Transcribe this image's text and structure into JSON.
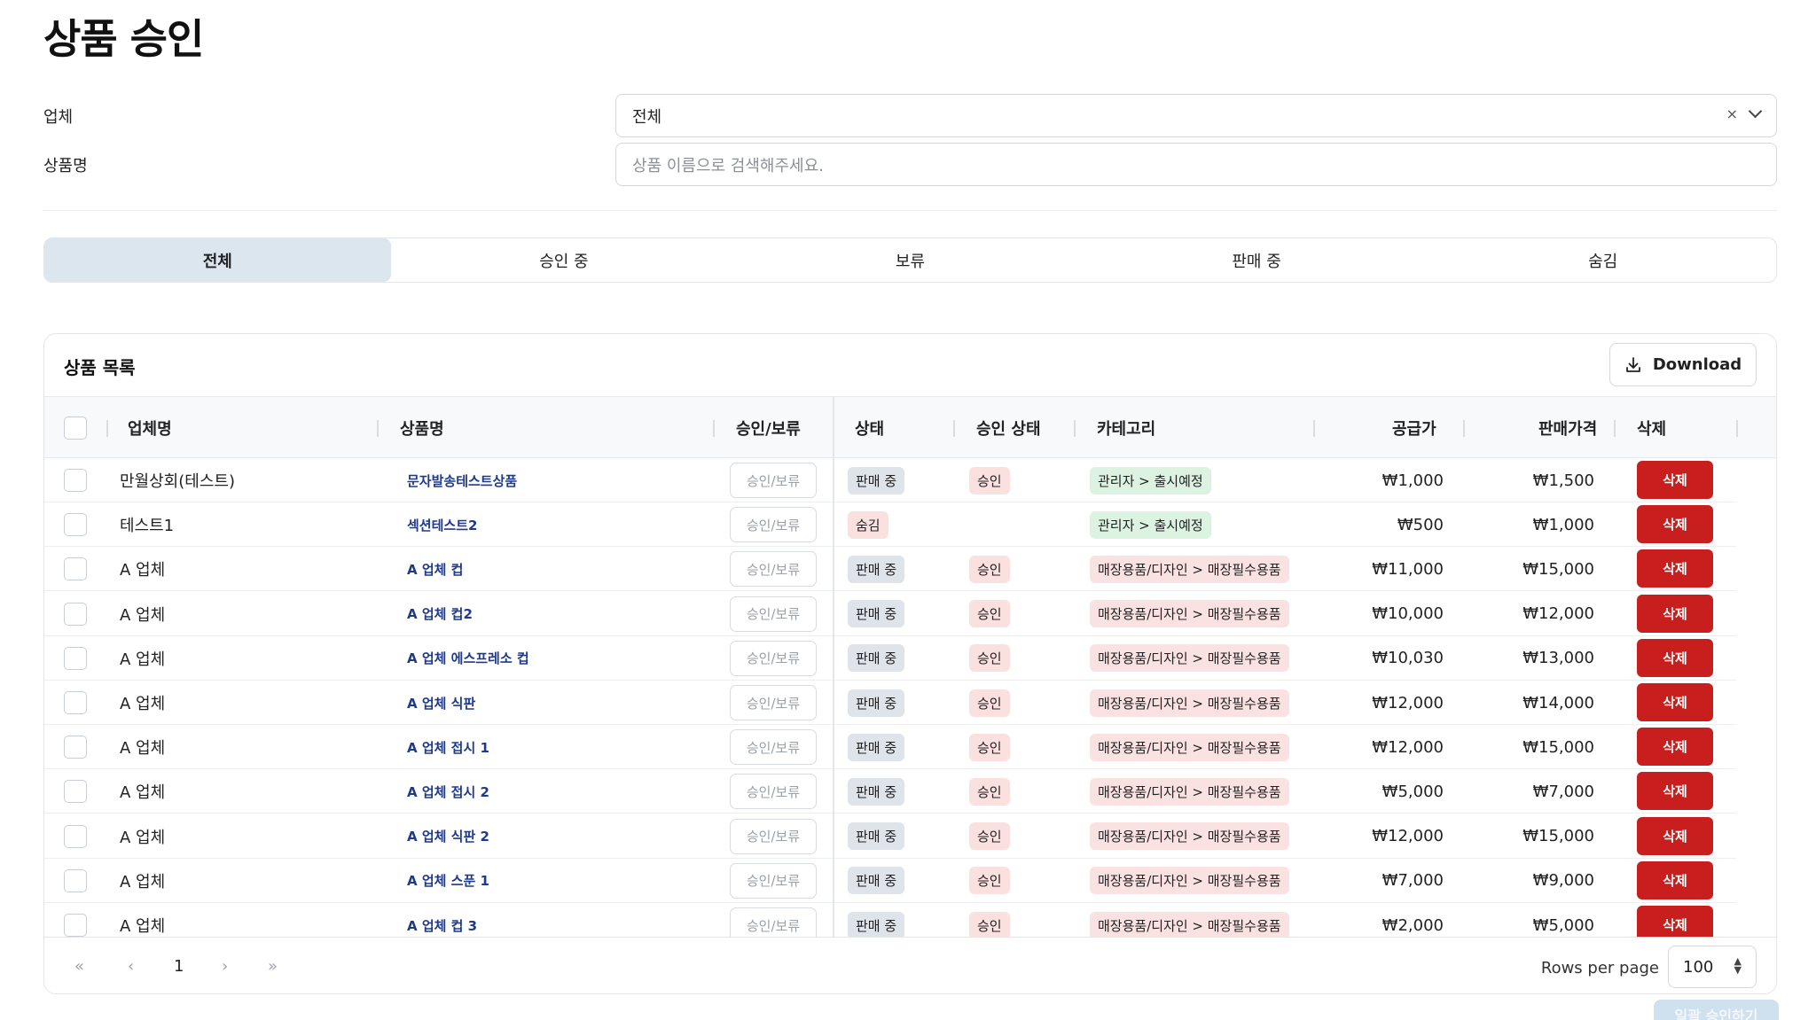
{
  "page": {
    "title": "상품 승인"
  },
  "filters": {
    "vendor": {
      "label": "업체",
      "value": "전체",
      "clear_icon": "×"
    },
    "product_name": {
      "label": "상품명",
      "placeholder": "상품 이름으로 검색해주세요."
    }
  },
  "tabs": [
    {
      "label": "전체",
      "active": true
    },
    {
      "label": "승인 중",
      "active": false
    },
    {
      "label": "보류",
      "active": false
    },
    {
      "label": "판매 중",
      "active": false
    },
    {
      "label": "숨김",
      "active": false
    }
  ],
  "product_list": {
    "title": "상품 목록",
    "download_label": "Download",
    "columns": [
      "업체명",
      "상품명",
      "승인/보류",
      "상태",
      "승인 상태",
      "카테고리",
      "공급가",
      "판매가격",
      "삭제"
    ],
    "rows": [
      {
        "vendor": "만월상회(테스트)",
        "product": "문자발송테스트상품",
        "action": "승인/보류",
        "status": "판매 중",
        "approval": "승인",
        "category": "관리자 > 출시예정",
        "supply": "₩1,000",
        "price": "₩1,500",
        "delete": "삭제"
      },
      {
        "vendor": "테스트1",
        "product": "섹션테스트2",
        "action": "승인/보류",
        "status": "숨김",
        "approval": "",
        "category": "관리자 > 출시예정",
        "supply": "₩500",
        "price": "₩1,000",
        "delete": "삭제"
      },
      {
        "vendor": "A 업체",
        "product": "A 업체 컵",
        "action": "승인/보류",
        "status": "판매 중",
        "approval": "승인",
        "category": "매장용품/디자인 > 매장필수용품",
        "supply": "₩11,000",
        "price": "₩15,000",
        "delete": "삭제"
      },
      {
        "vendor": "A 업체",
        "product": "A 업체 컵2",
        "action": "승인/보류",
        "status": "판매 중",
        "approval": "승인",
        "category": "매장용품/디자인 > 매장필수용품",
        "supply": "₩10,000",
        "price": "₩12,000",
        "delete": "삭제"
      },
      {
        "vendor": "A 업체",
        "product": "A 업체 에스프레소 컵",
        "action": "승인/보류",
        "status": "판매 중",
        "approval": "승인",
        "category": "매장용품/디자인 > 매장필수용품",
        "supply": "₩10,030",
        "price": "₩13,000",
        "delete": "삭제"
      },
      {
        "vendor": "A 업체",
        "product": "A 업체 식판",
        "action": "승인/보류",
        "status": "판매 중",
        "approval": "승인",
        "category": "매장용품/디자인 > 매장필수용품",
        "supply": "₩12,000",
        "price": "₩14,000",
        "delete": "삭제"
      },
      {
        "vendor": "A 업체",
        "product": "A 업체 접시 1",
        "action": "승인/보류",
        "status": "판매 중",
        "approval": "승인",
        "category": "매장용품/디자인 > 매장필수용품",
        "supply": "₩12,000",
        "price": "₩15,000",
        "delete": "삭제"
      },
      {
        "vendor": "A 업체",
        "product": "A 업체 접시 2",
        "action": "승인/보류",
        "status": "판매 중",
        "approval": "승인",
        "category": "매장용품/디자인 > 매장필수용품",
        "supply": "₩5,000",
        "price": "₩7,000",
        "delete": "삭제"
      },
      {
        "vendor": "A 업체",
        "product": "A 업체 식판 2",
        "action": "승인/보류",
        "status": "판매 중",
        "approval": "승인",
        "category": "매장용품/디자인 > 매장필수용품",
        "supply": "₩12,000",
        "price": "₩15,000",
        "delete": "삭제"
      },
      {
        "vendor": "A 업체",
        "product": "A 업체 스푼 1",
        "action": "승인/보류",
        "status": "판매 중",
        "approval": "승인",
        "category": "매장용품/디자인 > 매장필수용품",
        "supply": "₩7,000",
        "price": "₩9,000",
        "delete": "삭제"
      },
      {
        "vendor": "A 업체",
        "product": "A 업체 컵 3",
        "action": "승인/보류",
        "status": "판매 중",
        "approval": "승인",
        "category": "매장용품/디자인 > 매장필수용품",
        "supply": "₩2,000",
        "price": "₩5,000",
        "delete": "삭제"
      }
    ]
  },
  "pagination": {
    "first": "«",
    "prev": "‹",
    "current_page": "1",
    "next": "›",
    "last": "»",
    "rows_per_page_label": "Rows per page",
    "rows_per_page_value": "100"
  },
  "bulk_approve_label": "일괄 승인하기",
  "colors": {
    "delete": "#c81e1e",
    "link": "#1e3a8a",
    "active_tab": "#dce6ef"
  }
}
